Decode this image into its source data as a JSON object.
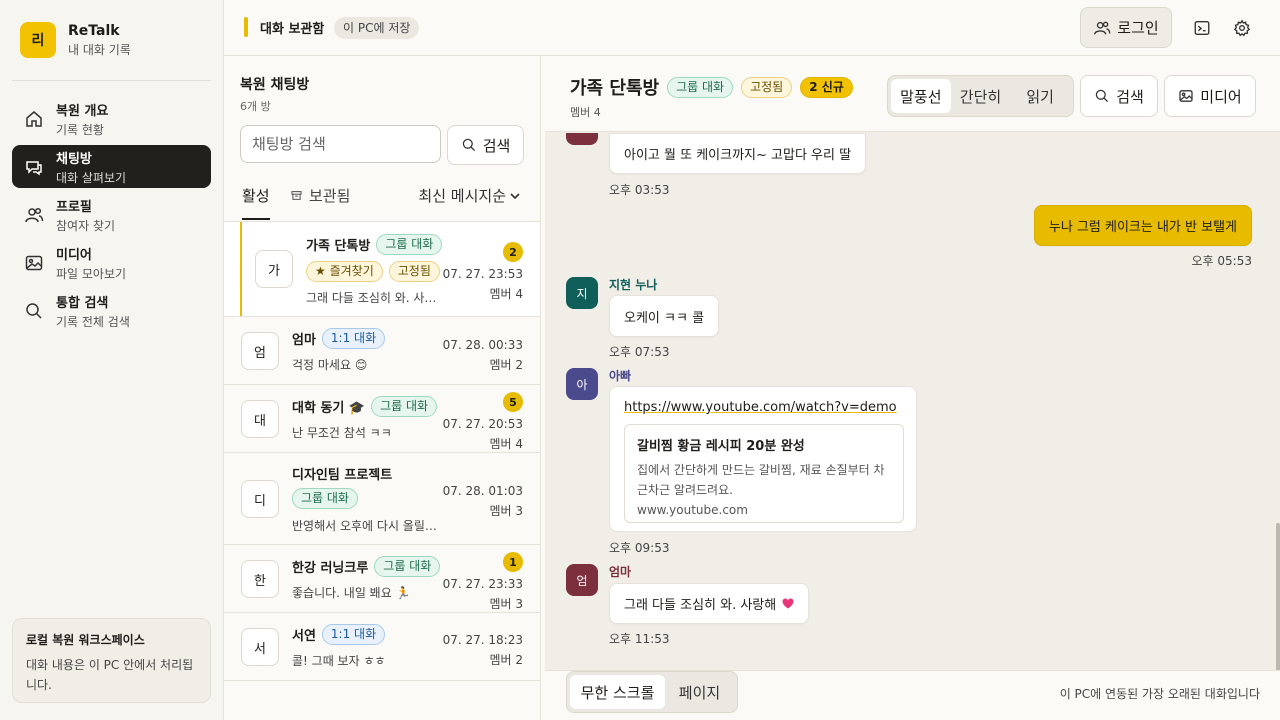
{
  "brand": {
    "logo": "리",
    "name": "ReTalk",
    "subtitle": "내 대화 기록"
  },
  "sidebar": {
    "items": [
      {
        "label": "복원 개요",
        "sub": "기록 현황",
        "icon": "home-icon"
      },
      {
        "label": "채팅방",
        "sub": "대화 살펴보기",
        "icon": "chat-icon"
      },
      {
        "label": "프로필",
        "sub": "참여자 찾기",
        "icon": "users-icon"
      },
      {
        "label": "미디어",
        "sub": "파일 모아보기",
        "icon": "image-icon"
      },
      {
        "label": "통합 검색",
        "sub": "기록 전체 검색",
        "icon": "search-icon"
      }
    ],
    "workspace_title": "로컬 복원 워크스페이스",
    "workspace_desc": "대화 내용은 이 PC 안에서 처리됩니다."
  },
  "topbar": {
    "title": "대화 보관함",
    "badge": "이 PC에 저장",
    "login": "로그인"
  },
  "list": {
    "title": "복원 채팅방",
    "count": "6개 방",
    "search_placeholder": "채팅방 검색",
    "search_button": "검색",
    "tab_active": "활성",
    "tab_archived": "보관됨",
    "sort": "최신 메시지순",
    "rooms": [
      {
        "avatar": "가",
        "name": "가족 단톡방",
        "tag": "그룹 대화",
        "fav": "★ 즐겨찾기",
        "pin": "고정됨",
        "preview": "그래 다들 조심히 와. 사…",
        "date": "07. 27. 23:53",
        "members": "멤버 4",
        "unread": "2"
      },
      {
        "avatar": "엄",
        "name": "엄마",
        "tag": "1:1 대화",
        "preview": "걱정 마세요 😊",
        "date": "07. 28. 00:33",
        "members": "멤버 2"
      },
      {
        "avatar": "대",
        "name": "대학 동기 🎓",
        "tag": "그룹 대화",
        "preview": "난 무조건 참석 ㅋㅋ",
        "date": "07. 27. 20:53",
        "members": "멤버 4",
        "unread": "5"
      },
      {
        "avatar": "디",
        "name": "디자인팀 프로젝트",
        "tag": "그룹 대화",
        "preview": "반영해서 오후에 다시 올릴…",
        "date": "07. 28. 01:03",
        "members": "멤버 3"
      },
      {
        "avatar": "한",
        "name": "한강 러닝크루",
        "tag": "그룹 대화",
        "preview": "좋습니다. 내일 봬요 🏃",
        "date": "07. 27. 23:33",
        "members": "멤버 3",
        "unread": "1"
      },
      {
        "avatar": "서",
        "name": "서연",
        "tag": "1:1 대화",
        "preview": "콜! 그때 보자 ㅎㅎ",
        "date": "07. 27. 18:23",
        "members": "멤버 2"
      }
    ]
  },
  "chat": {
    "title": "가족 단톡방",
    "tag": "그룹 대화",
    "pin": "고정됨",
    "new": "2 신규",
    "members": "멤버 4",
    "view_modes": [
      "말풍선",
      "간단히",
      "읽기"
    ],
    "search_button": "검색",
    "media_button": "미디어",
    "messages": {
      "m1_text": "아이고 뭘 또 케이크까지~ 고맙다 우리 딸",
      "m1_time": "오후 03:53",
      "m2_text": "누나 그럼 케이크는 내가 반 보탤게",
      "m2_time": "오후 05:53",
      "m3_sender": "지현 누나",
      "m3_avatar": "지",
      "m3_text": "오케이 ㅋㅋ 콜",
      "m3_time": "오후 07:53",
      "m4_sender": "아빠",
      "m4_avatar": "아",
      "m4_url": "https://www.youtube.com/watch?v=demo",
      "m4_card_title": "갈비찜 황금 레시피 20분 완성",
      "m4_card_desc": "집에서 간단하게 만드는 갈비찜, 재료 손질부터 차근차근 알려드려요.",
      "m4_card_domain": "www.youtube.com",
      "m4_time": "오후 09:53",
      "m5_sender": "엄마",
      "m5_avatar": "엄",
      "m5_text": "그래 다들 조심히 와. 사랑해",
      "m5_time": "오후 11:53"
    },
    "footer_modes": [
      "무한 스크롤",
      "페이지"
    ],
    "footer_note": "이 PC에 연동된 가장 오래된 대화입니다"
  },
  "colors": {
    "accent": "#e6bb00",
    "sidebar_active": "#22201c",
    "avatar_jihyun": "#0f5e5a",
    "avatar_dad": "#4a4a8c",
    "avatar_mom": "#7c2f3c"
  }
}
